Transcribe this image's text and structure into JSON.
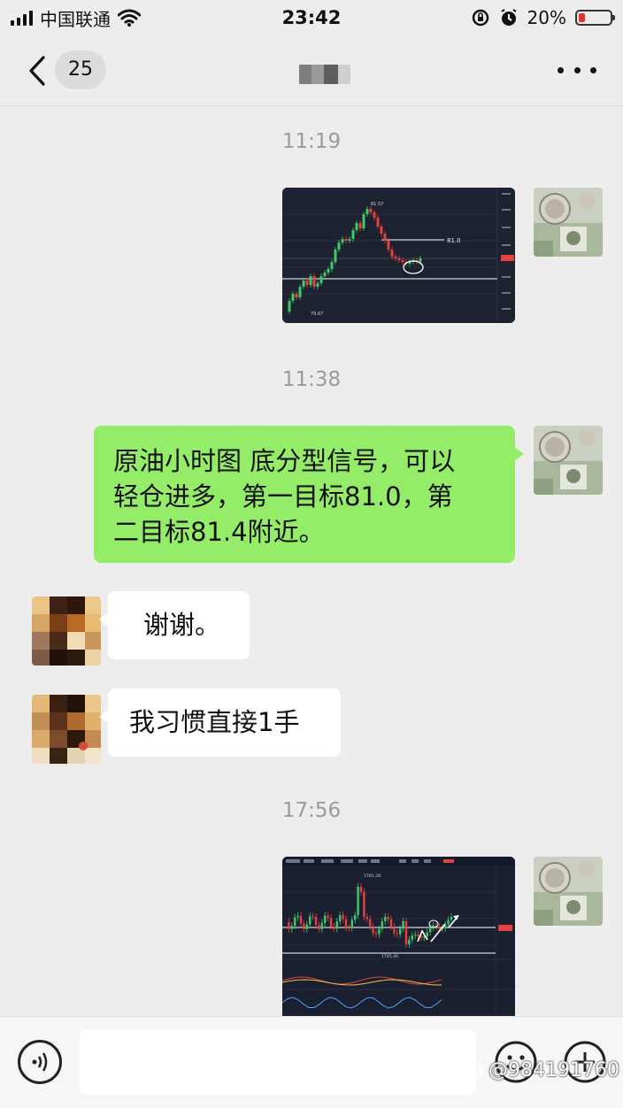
{
  "status_bar": {
    "carrier": "中国联通",
    "time": "23:42",
    "battery_percent_label": "20%",
    "battery_level": 0.2,
    "battery_color": "#e8322d"
  },
  "nav": {
    "unread_count": "25",
    "back_icon": "chevron-left-icon",
    "more_icon": "more-dots-icon"
  },
  "messages": [
    {
      "type": "timestamp",
      "text": "11:19"
    },
    {
      "type": "image",
      "from": "me",
      "chart": {
        "reference_line_label": "81.0",
        "high_label": "81.57",
        "low_label": "79.67"
      }
    },
    {
      "type": "timestamp",
      "text": "11:38"
    },
    {
      "type": "text",
      "from": "me",
      "lines": [
        "原油小时图 底分型信号，可以",
        "轻仓进多，第一目标81.0，第",
        "二目标81.4附近。"
      ]
    },
    {
      "type": "text",
      "from": "other",
      "text": "谢谢。"
    },
    {
      "type": "text",
      "from": "other",
      "text": "我习惯直接1手"
    },
    {
      "type": "timestamp",
      "text": "17:56"
    },
    {
      "type": "image",
      "from": "me",
      "chart": {
        "high_label": "1781.28",
        "low_label": "1745.40"
      }
    }
  ],
  "input_bar": {
    "voice_icon": "voice-icon",
    "emoji_icon": "emoji-icon",
    "plus_icon": "plus-icon",
    "text_value": "",
    "watermark": "@984191760"
  },
  "colors": {
    "my_bubble": "#95ec69",
    "other_bubble": "#ffffff",
    "background": "#ededed",
    "candle_up": "#3fc96b",
    "candle_down": "#e8413d"
  }
}
